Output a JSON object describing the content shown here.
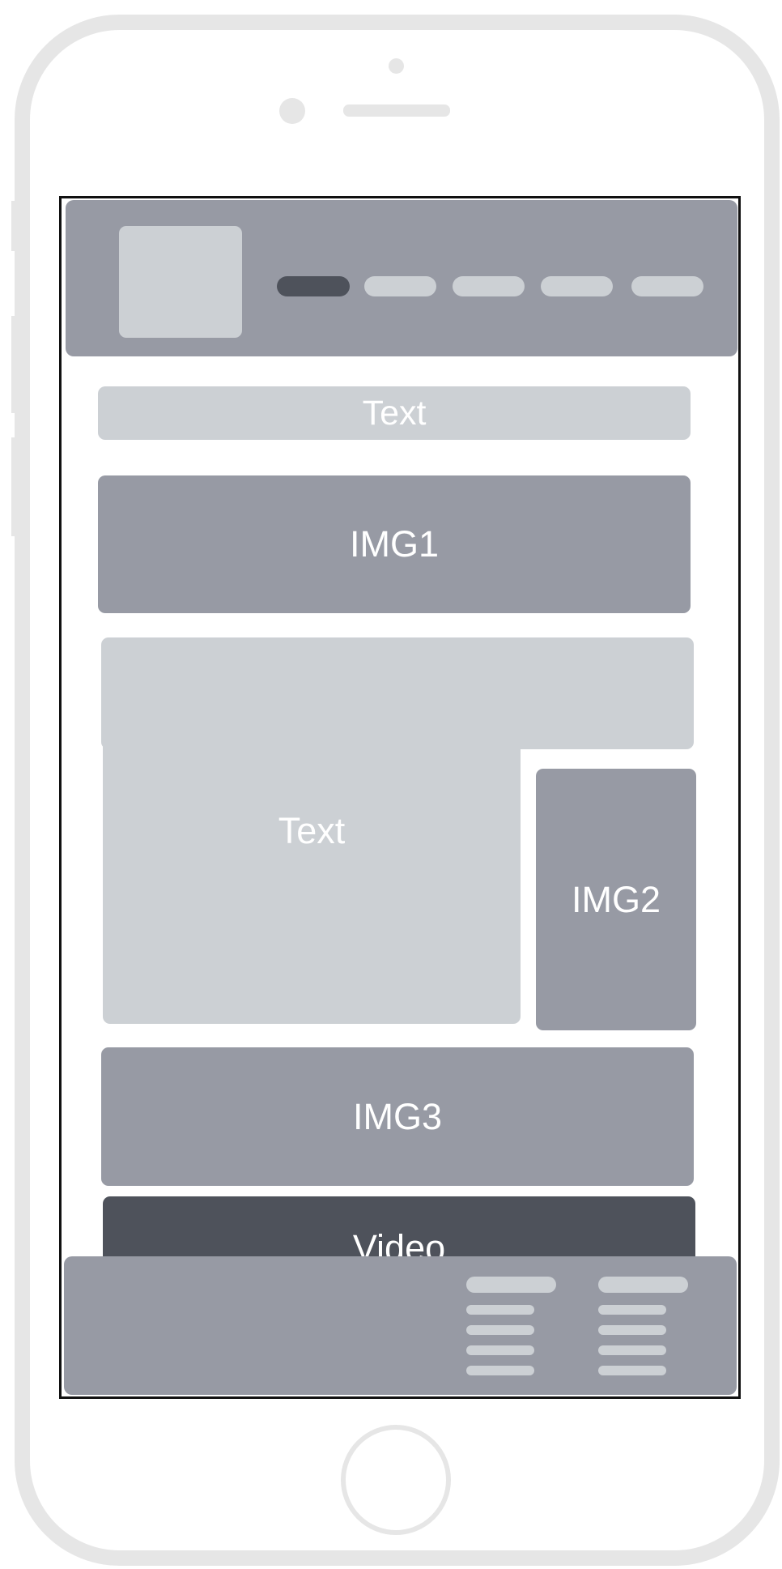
{
  "header": {
    "nav_items": [
      "active",
      "item",
      "item",
      "item",
      "item"
    ]
  },
  "content": {
    "top_text": "Text",
    "img1": "IMG1",
    "body_text": "Text",
    "img2": "IMG2",
    "img3": "IMG3",
    "video": "Video"
  },
  "colors": {
    "frame": "#e6e6e6",
    "dark": "#4e525b",
    "mid": "#979aa4",
    "light": "#ccd0d4"
  }
}
